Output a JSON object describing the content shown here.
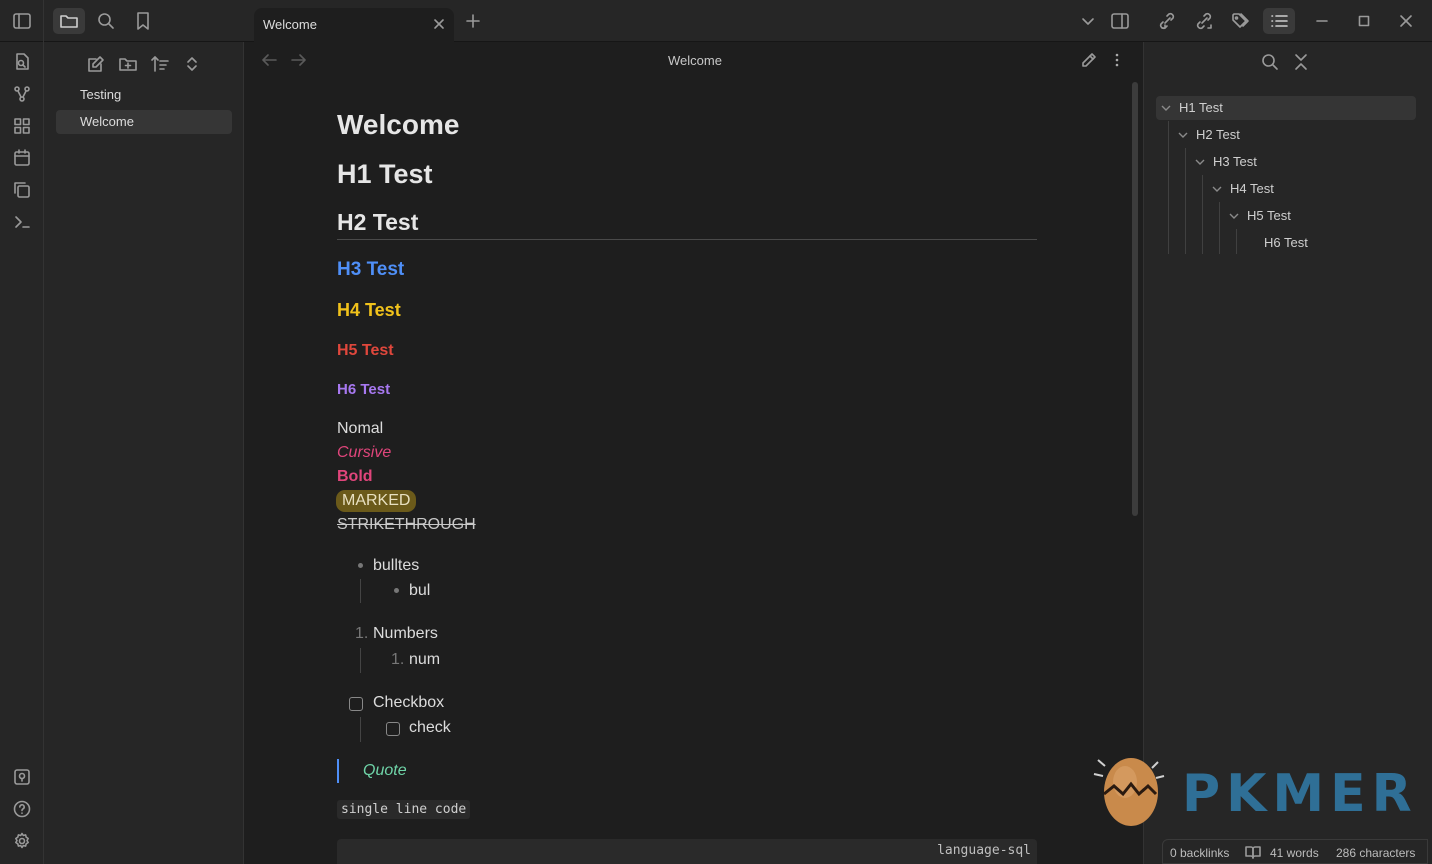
{
  "tabs": [
    {
      "label": "Welcome"
    }
  ],
  "view": {
    "title": "Welcome"
  },
  "explorer": {
    "files": [
      "Testing",
      "Welcome"
    ]
  },
  "doc": {
    "title": "Welcome",
    "h1": "H1 Test",
    "h2": "H2 Test",
    "h3": "H3 Test",
    "h4": "H4 Test",
    "h5": "H5 Test",
    "h6": "H6 Test",
    "normal": "Nomal",
    "cursive": "Cursive",
    "bold": "Bold",
    "marked": "MARKED",
    "strike": "STRIKETHROUGH",
    "bullet1": "bulltes",
    "bullet2": "bul",
    "num_marker": "1.",
    "num1": "Numbers",
    "num2": "num",
    "check1": "Checkbox",
    "check2": "check",
    "quote": "Quote",
    "inline_code": "single line code",
    "code_lang": "language-sql"
  },
  "outline": [
    "H1 Test",
    "H2 Test",
    "H3 Test",
    "H4 Test",
    "H5 Test",
    "H6 Test"
  ],
  "status": {
    "backlinks": "0 backlinks",
    "words": "41 words",
    "chars": "286 characters"
  },
  "watermark": {
    "text": "PKMER"
  },
  "colors": {
    "h3": "#4f8ff7",
    "h4": "#f1c21b",
    "h5": "#e0473c",
    "h6": "#a778f0",
    "accent_pink": "#e0457b",
    "quote": "#6fd4a8",
    "mark_bg": "#6b5a1a"
  }
}
